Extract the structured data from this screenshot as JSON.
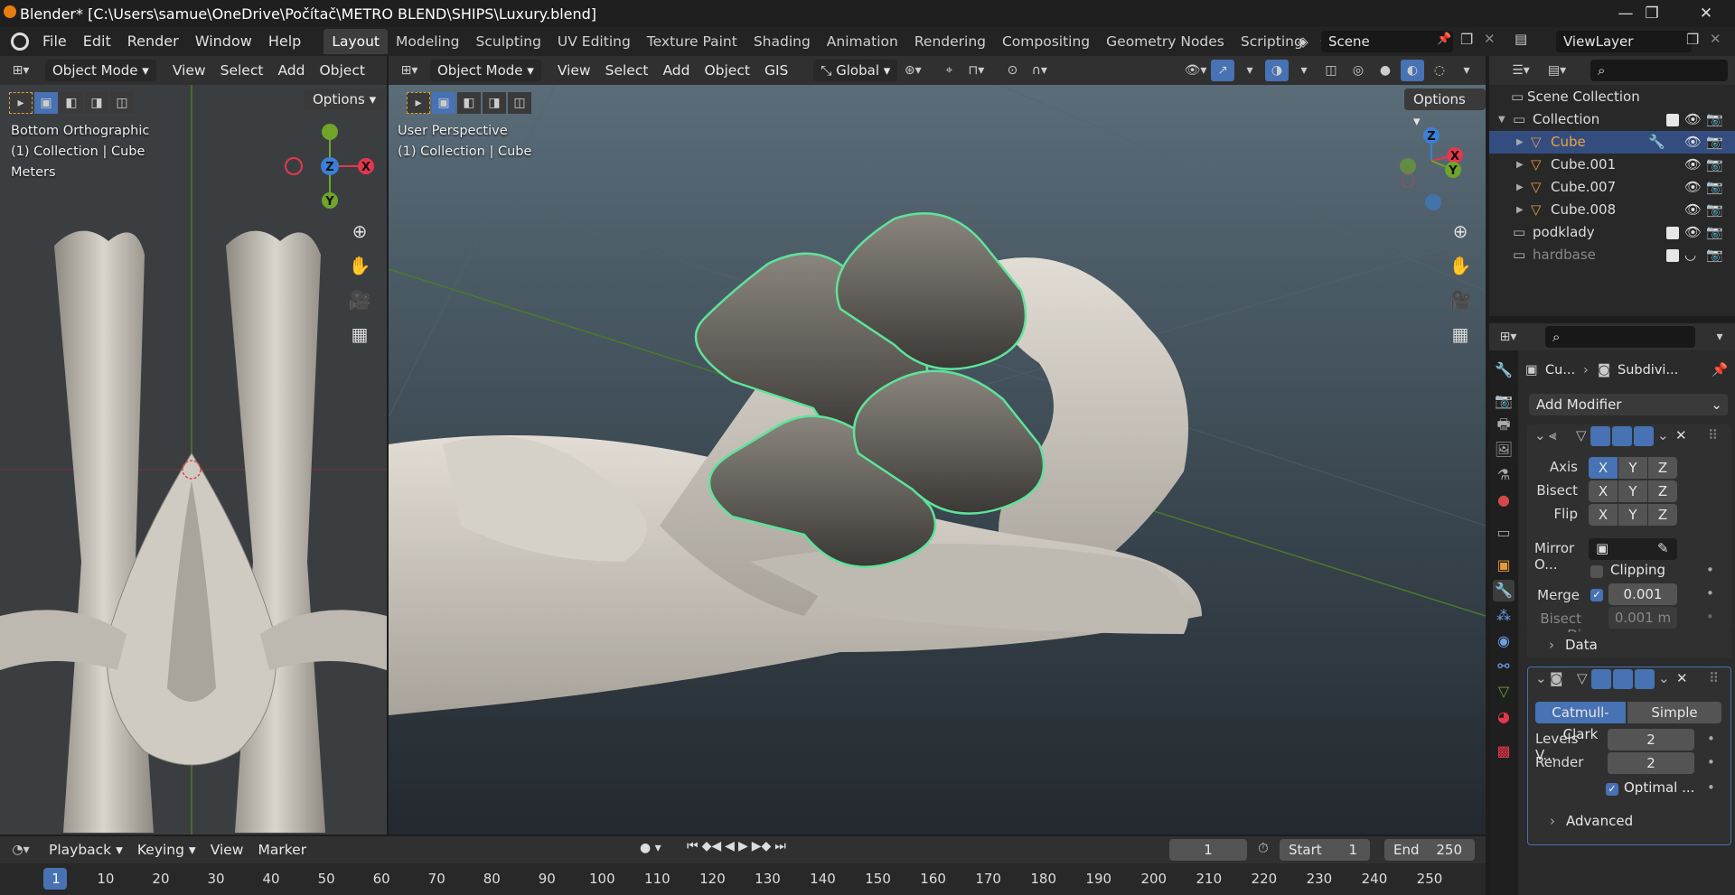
{
  "titlebar": {
    "title": "Blender* [C:\\Users\\samue\\OneDrive\\Počítač\\METRO BLEND\\SHIPS\\Luxury.blend]",
    "minimize": "—",
    "maximize": "❐",
    "close": "✕"
  },
  "menu": [
    "File",
    "Edit",
    "Render",
    "Window",
    "Help"
  ],
  "workspaces": [
    "Layout",
    "Modeling",
    "Sculpting",
    "UV Editing",
    "Texture Paint",
    "Shading",
    "Animation",
    "Rendering",
    "Compositing",
    "Geometry Nodes",
    "Scripting"
  ],
  "active_workspace": "Layout",
  "scene": "Scene",
  "viewlayer": "ViewLayer",
  "left_view": {
    "mode": "Object Mode",
    "menus": [
      "View",
      "Select",
      "Add",
      "Object"
    ],
    "options": "Options",
    "info": [
      "Bottom Orthographic",
      "(1) Collection | Cube",
      "Meters"
    ],
    "gizmo": {
      "top": "",
      "left": "",
      "center": "Z",
      "right": "X",
      "bottom": "Y"
    }
  },
  "main_view": {
    "mode": "Object Mode",
    "menus": [
      "View",
      "Select",
      "Add",
      "Object",
      "GIS"
    ],
    "transform": "Global",
    "options": "Options",
    "info": [
      "User Perspective",
      "(1) Collection | Cube"
    ],
    "gizmo": {
      "z": "Z",
      "x": "X",
      "y": "Y"
    }
  },
  "outliner": {
    "root": "Scene Collection",
    "items": [
      {
        "name": "Collection",
        "level": 1,
        "type": "collection"
      },
      {
        "name": "Cube",
        "level": 2,
        "type": "mesh",
        "selected": true
      },
      {
        "name": "Cube.001",
        "level": 2,
        "type": "mesh"
      },
      {
        "name": "Cube.007",
        "level": 2,
        "type": "mesh"
      },
      {
        "name": "Cube.008",
        "level": 2,
        "type": "mesh"
      },
      {
        "name": "podklady",
        "level": 1,
        "type": "collection"
      },
      {
        "name": "hardbase",
        "level": 1,
        "type": "collection",
        "dim": true
      }
    ]
  },
  "properties": {
    "breadcrumb_object": "Cu...",
    "breadcrumb_modifier": "Subdivi...",
    "add_modifier": "Add Modifier",
    "mirror": {
      "axis_label": "Axis",
      "bisect_label": "Bisect",
      "flip_label": "Flip",
      "axes": [
        "X",
        "Y",
        "Z"
      ],
      "mirror_object_label": "Mirror O...",
      "clipping": "Clipping",
      "merge_label": "Merge",
      "merge_value": "0.001",
      "bisect_dist_label": "Bisect Di",
      "bisect_dist_value": "0.001 m",
      "data": "Data"
    },
    "subdiv": {
      "catmull": "Catmull-Clark",
      "simple": "Simple",
      "levels_label": "Levels V...",
      "levels_value": "2",
      "render_label": "Render",
      "render_value": "2",
      "optimal": "Optimal ...",
      "advanced": "Advanced"
    }
  },
  "timeline": {
    "menus": [
      "Playback",
      "Keying",
      "View",
      "Marker"
    ],
    "current_frame": "1",
    "start_label": "Start",
    "start": "1",
    "end_label": "End",
    "end": "250",
    "ticks": [
      "1",
      "10",
      "20",
      "30",
      "40",
      "50",
      "60",
      "70",
      "80",
      "90",
      "100",
      "110",
      "120",
      "130",
      "140",
      "150",
      "160",
      "170",
      "180",
      "190",
      "200",
      "210",
      "220",
      "230",
      "240",
      "250"
    ]
  },
  "colors": {
    "accent": "#4772b3",
    "selection_outline": "#5ee39a",
    "x_axis": "#e5364e",
    "y_axis": "#6ea52a",
    "z_axis": "#3b7fd6"
  }
}
